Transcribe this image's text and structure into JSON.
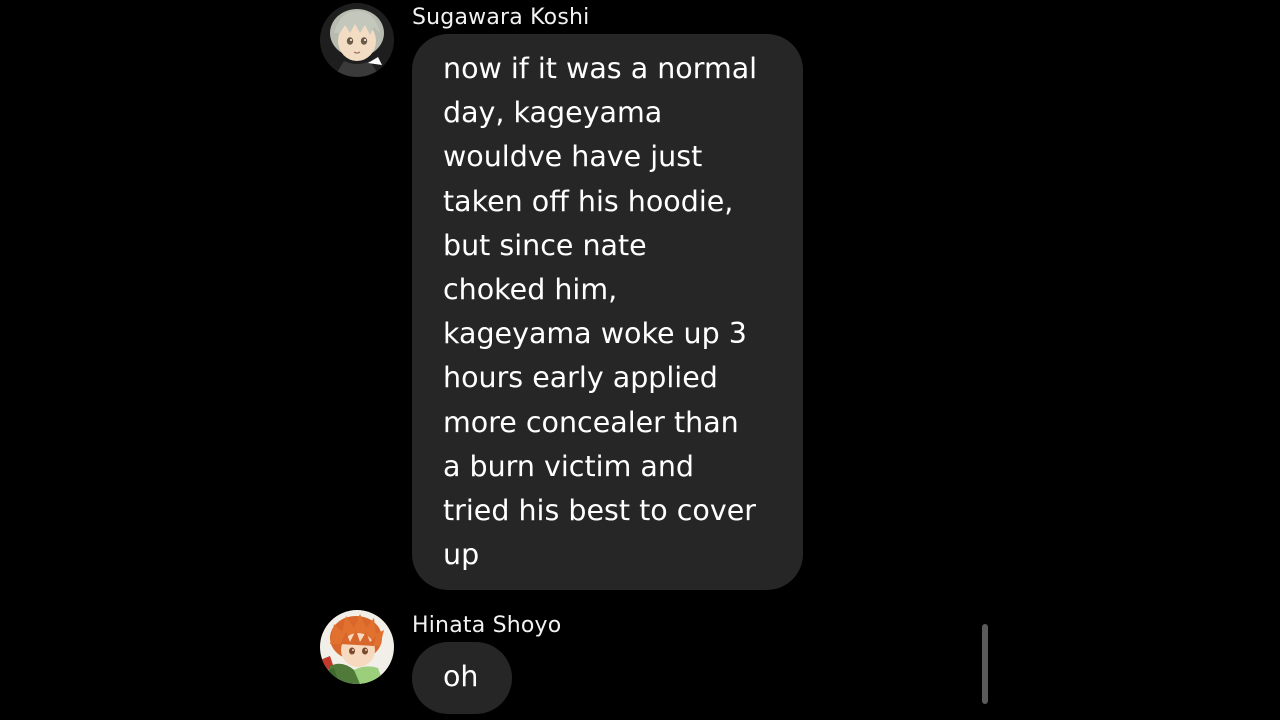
{
  "messages": [
    {
      "sender": "Sugawara Koshi",
      "avatar_icon": "sugawara-avatar-icon",
      "lines": [
        "now if it was a normal",
        "day, kageyama",
        "wouldve have just",
        "taken off his hoodie,",
        "but since nate",
        "choked him,",
        "kageyama woke up 3",
        "hours early applied",
        "more concealer than",
        "a burn victim and",
        "tried his best to cover",
        "up"
      ]
    },
    {
      "sender": "Hinata Shoyo",
      "avatar_icon": "hinata-avatar-icon",
      "lines": [
        "oh"
      ]
    }
  ],
  "colors": {
    "background": "#000000",
    "bubble": "#262626",
    "text": "#ffffff",
    "scrollbar": "#5a5a5a"
  }
}
